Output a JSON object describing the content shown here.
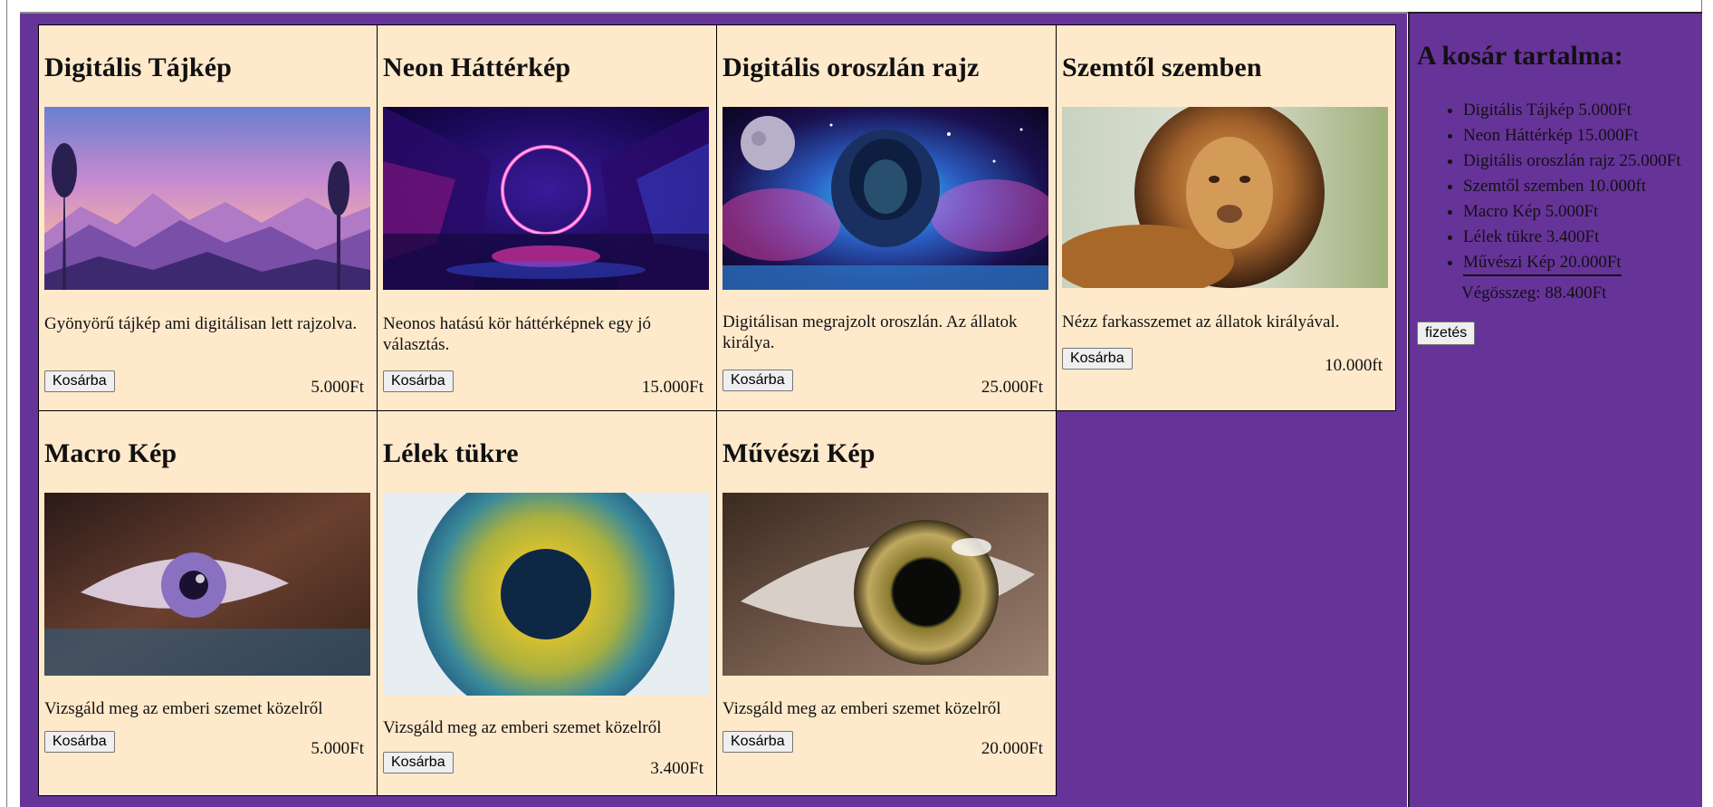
{
  "products": [
    {
      "title": "Digitális Tájkép",
      "desc": "Gyönyörű tájkép ami digitálisan lett rajzolva.",
      "button": "Kosárba",
      "price": "5.000Ft",
      "image": "landscape-image"
    },
    {
      "title": "Neon Háttérkép",
      "desc": "Neonos hatású kör háttérképnek egy jó választás.",
      "button": "Kosárba",
      "price": "15.000Ft",
      "image": "neon-ring-image"
    },
    {
      "title": "Digitális oroszlán rajz",
      "desc": "Digitálisan megrajzolt oroszlán. Az állatok királya.",
      "button": "Kosárba",
      "price": "25.000Ft",
      "image": "digital-lion-image"
    },
    {
      "title": "Szemtől szemben",
      "desc": "Nézz farkasszemet az állatok királyával.",
      "button": "Kosárba",
      "price": "10.000ft",
      "image": "lion-photo-image"
    },
    {
      "title": "Macro Kép",
      "desc": "Vizsgáld meg az emberi szemet közelről",
      "button": "Kosárba",
      "price": "5.000Ft",
      "image": "macro-eye-image"
    },
    {
      "title": "Lélek tükre",
      "desc": "Vizsgáld meg az emberi szemet közelről",
      "button": "Kosárba",
      "price": "3.400Ft",
      "image": "iris-image"
    },
    {
      "title": "Művészi Kép",
      "desc": "Vizsgáld meg az emberi szemet közelről",
      "button": "Kosárba",
      "price": "20.000Ft",
      "image": "brown-eye-image"
    }
  ],
  "cart": {
    "title": "A kosár tartalma:",
    "items": [
      "Digitális Tájkép 5.000Ft",
      "Neon Háttérkép 15.000Ft",
      "Digitális oroszlán rajz 25.000Ft",
      "Szemtől szemben 10.000ft",
      "Macro Kép 5.000Ft",
      "Lélek tükre 3.400Ft",
      "Művészi Kép 20.000Ft"
    ],
    "total": "Végösszeg: 88.400Ft",
    "pay_button": "fizetés"
  },
  "colors": {
    "page_bg": "#663399",
    "card_bg": "#ffe9cb"
  }
}
